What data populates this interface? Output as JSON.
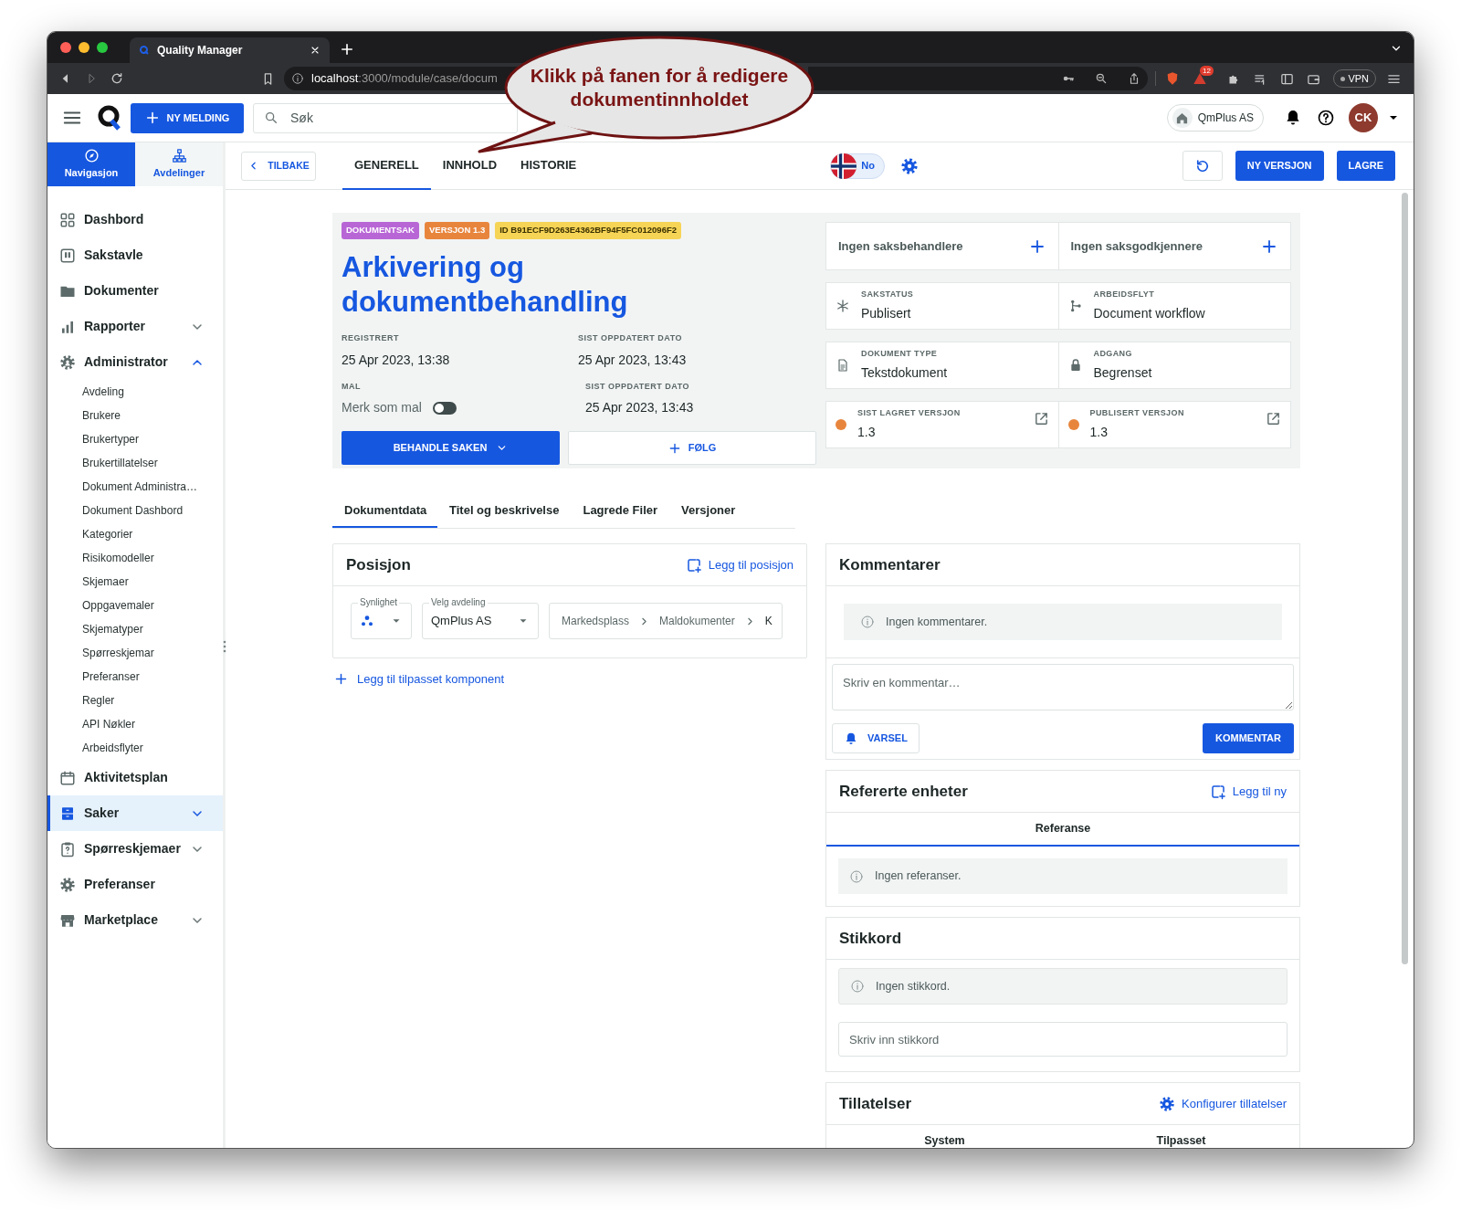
{
  "browser": {
    "tab_title": "Quality Manager",
    "url_host": "localhost",
    "url_path": ":3000/module/case/docum",
    "alert_badge": "12",
    "vpn": "VPN"
  },
  "callout": {
    "text": "Klikk på fanen for å redigere dokumentinnholdet"
  },
  "header": {
    "new_button": "NY MELDING",
    "search_placeholder": "Søk",
    "company": "QmPlus AS",
    "avatar": "CK"
  },
  "sidebar": {
    "modes": [
      {
        "label": "Navigasjon",
        "selected": true
      },
      {
        "label": "Avdelinger",
        "selected": false
      }
    ],
    "items": [
      {
        "label": "Dashbord",
        "selected": false
      },
      {
        "label": "Sakstavle",
        "selected": false
      },
      {
        "label": "Dokumenter",
        "selected": false
      },
      {
        "label": "Rapporter",
        "selected": false,
        "expanded": false
      },
      {
        "label": "Administrator",
        "selected": false,
        "expanded": true,
        "children": [
          {
            "label": "Avdeling",
            "selected": false
          },
          {
            "label": "Brukere",
            "selected": false
          },
          {
            "label": "Brukertyper",
            "selected": false
          },
          {
            "label": "Brukertillatelser",
            "selected": false
          },
          {
            "label": "Dokument Administra…",
            "selected": false
          },
          {
            "label": "Dokument Dashbord",
            "selected": false
          },
          {
            "label": "Kategorier",
            "selected": false
          },
          {
            "label": "Risikomodeller",
            "selected": false
          },
          {
            "label": "Skjemaer",
            "selected": false
          },
          {
            "label": "Oppgavemaler",
            "selected": false
          },
          {
            "label": "Skjematyper",
            "selected": false
          },
          {
            "label": "Spørreskjemar",
            "selected": false
          },
          {
            "label": "Preferanser",
            "selected": false
          },
          {
            "label": "Regler",
            "selected": false
          },
          {
            "label": "API Nøkler",
            "selected": false
          },
          {
            "label": "Arbeidsflyter",
            "selected": false
          }
        ]
      },
      {
        "label": "Aktivitetsplan",
        "selected": false
      },
      {
        "label": "Saker",
        "selected": true,
        "expanded": false
      },
      {
        "label": "Spørreskjemaer",
        "selected": false,
        "expanded": false
      },
      {
        "label": "Preferanser",
        "selected": false
      },
      {
        "label": "Marketplace",
        "selected": false,
        "expanded": false
      }
    ]
  },
  "subheader": {
    "back": "TILBAKE",
    "tabs": [
      {
        "label": "GENERELL",
        "selected": true
      },
      {
        "label": "INNHOLD",
        "selected": false
      },
      {
        "label": "HISTORIE",
        "selected": false
      }
    ],
    "language": "No",
    "buttons": [
      "NY VERSJON",
      "LAGRE"
    ]
  },
  "case": {
    "tags": [
      {
        "text": "DOKUMENTSAK",
        "color": "#b866d6"
      },
      {
        "text": "VERSJON 1.3",
        "color": "#e8853d"
      },
      {
        "text": "ID B91ECF9D263E4362BF94F5FC012096F2",
        "color": "#f6d456"
      }
    ],
    "title": "Arkivering og dokumentbehandling",
    "registered": {
      "label": "REGISTRERT",
      "value": "25 Apr 2023, 13:38"
    },
    "updated": {
      "label": "SIST OPPDATERT DATO",
      "value": "25 Apr 2023, 13:43"
    },
    "template": {
      "label": "MAL",
      "toggle_label": "Merk som mal",
      "on": false
    },
    "updated_again": {
      "label": "SIST OPPDATERT DATO",
      "value": "25 Apr 2023, 13:43"
    },
    "primary_action": "BEHANDLE SAKEN",
    "follow": "FØLG"
  },
  "assignees": [
    "Ingen saksbehandlere",
    "Ingen saksgodkjennere"
  ],
  "info_cards": [
    {
      "kind": "status",
      "label": "SAKSTATUS",
      "value": "Publisert"
    },
    {
      "kind": "workflow",
      "label": "ARBEIDSFLYT",
      "value": "Document workflow"
    },
    {
      "kind": "doctype",
      "label": "DOKUMENT TYPE",
      "value": "Tekstdokument"
    },
    {
      "kind": "access",
      "label": "ADGANG",
      "value": "Begrenset"
    },
    {
      "kind": "version",
      "label": "SIST LAGRET VERSJON",
      "value": "1.3",
      "color": "#e8853d"
    },
    {
      "kind": "version",
      "label": "PUBLISERT VERSJON",
      "value": "1.3",
      "color": "#e8853d"
    }
  ],
  "doc_tabs": [
    {
      "label": "Dokumentdata",
      "selected": true
    },
    {
      "label": "Titel og beskrivelse",
      "selected": false
    },
    {
      "label": "Lagrede Filer",
      "selected": false
    },
    {
      "label": "Versjoner",
      "selected": false
    }
  ],
  "position": {
    "title": "Posisjon",
    "add": "Legg til posisjon",
    "visibility_label": "Synlighet",
    "department_label": "Velg avdeling",
    "department": "QmPlus AS",
    "breadcrumb": [
      "Markedsplass",
      "Maldokumenter",
      "K"
    ]
  },
  "add_component": "Legg til tilpasset komponent",
  "comments": {
    "title": "Kommentarer",
    "empty": "Ingen kommentarer.",
    "placeholder": "Skriv en kommentar…",
    "notify": "VARSEL",
    "submit": "KOMMENTAR"
  },
  "references": {
    "title": "Refererte enheter",
    "add": "Legg til ny",
    "tabs": [
      {
        "label": "Referanse",
        "selected": true
      }
    ],
    "empty": "Ingen referanser."
  },
  "keywords": {
    "title": "Stikkord",
    "empty": "Ingen stikkord.",
    "placeholder": "Skriv inn stikkord"
  },
  "permissions": {
    "title": "Tillatelser",
    "configure": "Konfigurer tillatelser",
    "columns": [
      "System",
      "Tilpasset"
    ]
  }
}
